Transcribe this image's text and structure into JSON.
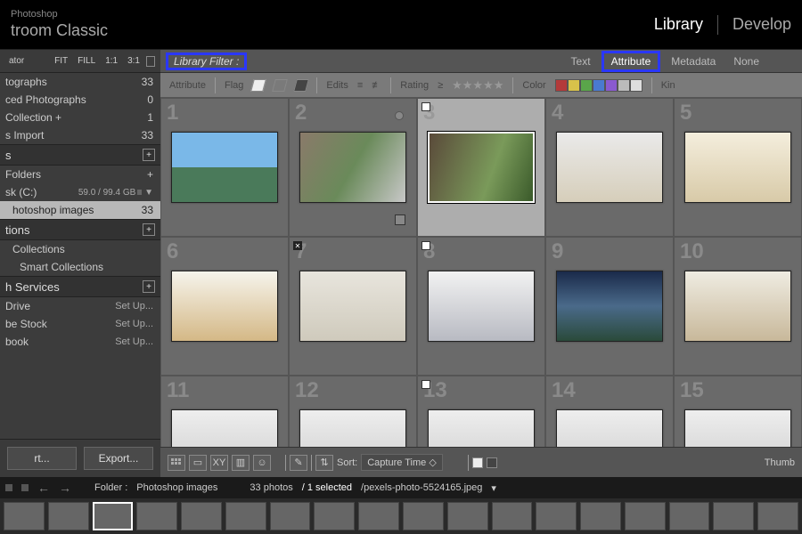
{
  "app": {
    "line1": "Photoshop",
    "line2": "troom Classic"
  },
  "modules": {
    "library": "Library",
    "develop": "Develop"
  },
  "navigator": {
    "title": "ator",
    "fit": "FIT",
    "fill": "FILL",
    "r11": "1:1",
    "r31": "3:1"
  },
  "catalog": {
    "rows": [
      {
        "label": "tographs",
        "count": "33"
      },
      {
        "label": "ced Photographs",
        "count": "0"
      },
      {
        "label": "Collection  +",
        "count": "1"
      },
      {
        "label": "s Import",
        "count": "33"
      }
    ]
  },
  "folders": {
    "title": "s",
    "add": "Folders",
    "volume_label": "sk (C:)",
    "volume_usage": "59.0 / 99.4 GB",
    "folder_name": "hotoshop images",
    "folder_count": "33"
  },
  "collections": {
    "title": "tions",
    "rows": [
      "Collections",
      "Smart Collections"
    ]
  },
  "publish": {
    "title": "h Services",
    "rows": [
      {
        "label": "Drive",
        "action": "Set Up..."
      },
      {
        "label": "be Stock",
        "action": "Set Up..."
      },
      {
        "label": "book",
        "action": "Set Up..."
      }
    ]
  },
  "export": {
    "btn1": "rt...",
    "btn2": "Export..."
  },
  "library_filter": {
    "label": "Library Filter :",
    "tabs": {
      "text": "Text",
      "attribute": "Attribute",
      "metadata": "Metadata",
      "none": "None"
    }
  },
  "attribute_bar": {
    "attribute": "Attribute",
    "flag": "Flag",
    "edits": "Edits",
    "rating": "Rating",
    "rating_op": "≥",
    "color": "Color",
    "kind": "Kin",
    "swatches": [
      "#b33a3a",
      "#d8c24a",
      "#5aa64a",
      "#4a7ad0",
      "#8a5ad0",
      "#bbb",
      "#ddd"
    ]
  },
  "grid": {
    "cells": [
      {
        "n": "1",
        "cls": "tg1"
      },
      {
        "n": "2",
        "cls": "tg2",
        "circle": true,
        "br_badge": true
      },
      {
        "n": "3",
        "cls": "tg3",
        "selected": true,
        "flag": true
      },
      {
        "n": "4",
        "cls": "tg4"
      },
      {
        "n": "5",
        "cls": "tg5"
      },
      {
        "n": "6",
        "cls": "tg6"
      },
      {
        "n": "7",
        "cls": "tg7",
        "reject": true
      },
      {
        "n": "8",
        "cls": "tg8",
        "flag": true
      },
      {
        "n": "9",
        "cls": "tg9"
      },
      {
        "n": "10",
        "cls": "tg10"
      },
      {
        "n": "11",
        "cls": "tg11"
      },
      {
        "n": "12",
        "cls": "tg11"
      },
      {
        "n": "13",
        "cls": "tg11",
        "flag": true
      },
      {
        "n": "14",
        "cls": "tg11"
      },
      {
        "n": "15",
        "cls": "tg11"
      }
    ]
  },
  "toolbar": {
    "sort_label": "Sort:",
    "sort_value": "Capture Time",
    "thumbnails": "Thumb"
  },
  "status": {
    "breadcrumb_prefix": "Folder :",
    "breadcrumb_folder": "Photoshop images",
    "count_prefix": "33 photos",
    "selected": "/ 1 selected",
    "filename": "/pexels-photo-5524165.jpeg"
  }
}
